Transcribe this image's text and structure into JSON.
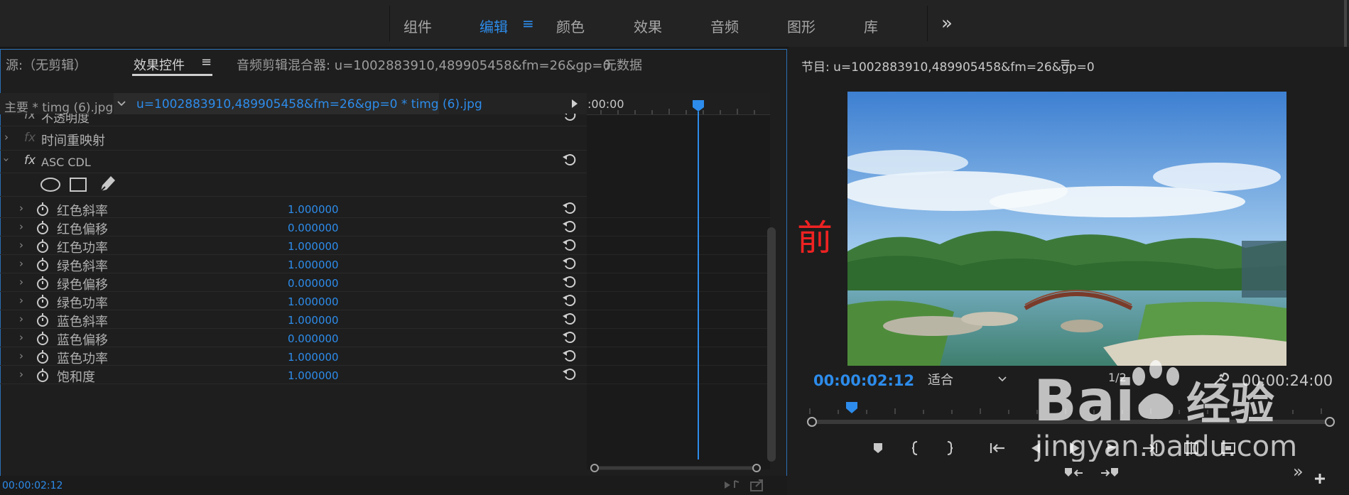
{
  "workspace_tabs": [
    {
      "label": "组件",
      "active": false
    },
    {
      "label": "编辑",
      "active": true
    },
    {
      "label": "颜色",
      "active": false
    },
    {
      "label": "效果",
      "active": false
    },
    {
      "label": "音频",
      "active": false
    },
    {
      "label": "图形",
      "active": false
    },
    {
      "label": "库",
      "active": false
    }
  ],
  "workspace_menu_icon": "≡",
  "workspace_more": "»",
  "left_panel": {
    "tabs": [
      {
        "label": "源:（无剪辑）"
      },
      {
        "label": "效果控件",
        "active": true
      },
      {
        "label": "音频剪辑混合器: u=1002883910,489905458&fm=26&gp=0"
      },
      {
        "label": "元数据"
      }
    ],
    "tab_menu_icon": "≡",
    "master_clip": "主要 * timg (6).jpg",
    "active_clip": "u=1002883910,489905458&fm=26&gp=0 * timg (6).jpg",
    "ruler_time": ":00:00",
    "partial_row": "不透明度",
    "fx_time_remap": "时间重映射",
    "fx_asc_cdl": "ASC CDL",
    "fx_symbol": "fx",
    "properties": [
      {
        "label": "红色斜率",
        "value": "1.000000"
      },
      {
        "label": "红色偏移",
        "value": "0.000000"
      },
      {
        "label": "红色功率",
        "value": "1.000000"
      },
      {
        "label": "绿色斜率",
        "value": "1.000000"
      },
      {
        "label": "绿色偏移",
        "value": "0.000000"
      },
      {
        "label": "绿色功率",
        "value": "1.000000"
      },
      {
        "label": "蓝色斜率",
        "value": "1.000000"
      },
      {
        "label": "蓝色偏移",
        "value": "0.000000"
      },
      {
        "label": "蓝色功率",
        "value": "1.000000"
      },
      {
        "label": "饱和度",
        "value": "1.000000"
      }
    ],
    "status_timecode": "00:00:02:12"
  },
  "program": {
    "title": "节目: u=1002883910,489905458&fm=26&gp=0",
    "menu_icon": "≡",
    "annotation": "前",
    "timecode": "00:00:02:12",
    "fit": "适合",
    "quality": "1/2",
    "duration": "00:00:24:00"
  },
  "watermark": {
    "brand": "Bai",
    "brand2": "经验",
    "url": "jingyan.baidu.com"
  },
  "colors": {
    "accent": "#2d8ceb",
    "annotation": "#e22222"
  }
}
